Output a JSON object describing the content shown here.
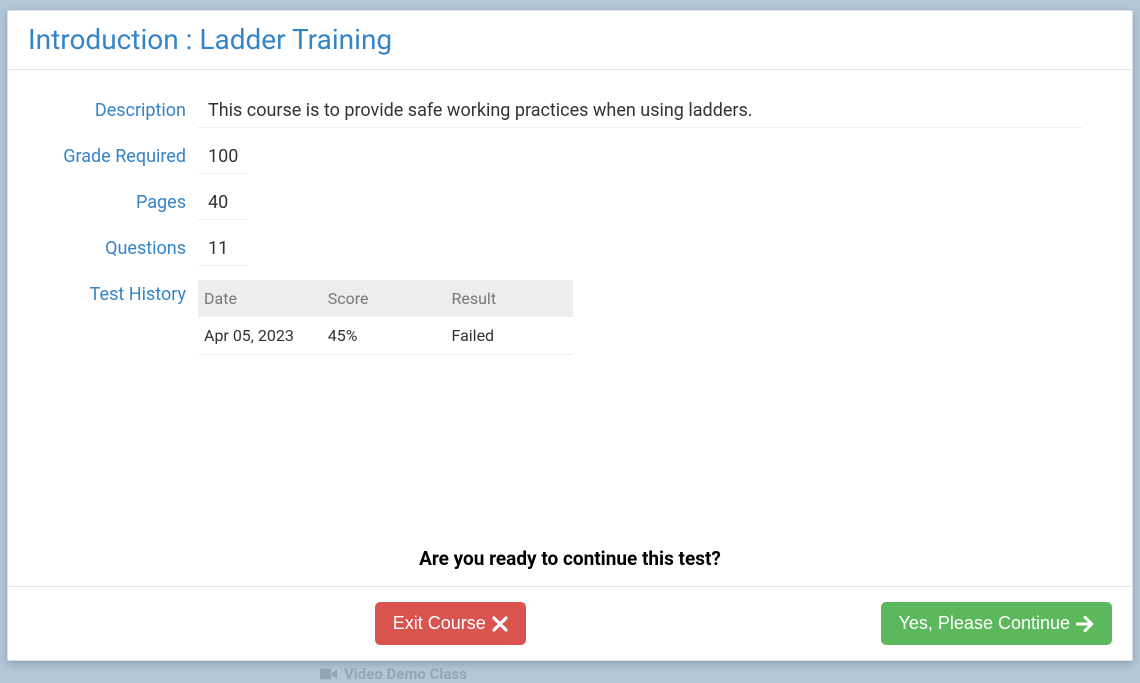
{
  "modal": {
    "title": "Introduction : Ladder Training"
  },
  "fields": {
    "description_label": "Description",
    "description_value": "This course is to provide safe working practices when using ladders.",
    "grade_label": "Grade Required",
    "grade_value": "100",
    "pages_label": "Pages",
    "pages_value": "40",
    "questions_label": "Questions",
    "questions_value": "11",
    "history_label": "Test History"
  },
  "history": {
    "headers": {
      "date": "Date",
      "score": "Score",
      "result": "Result"
    },
    "rows": [
      {
        "date": "Apr 05, 2023",
        "score": "45%",
        "result": "Failed"
      }
    ]
  },
  "prompt": "Are you ready to continue this test?",
  "buttons": {
    "exit": "Exit Course",
    "continue": "Yes, Please Continue"
  },
  "background": {
    "hint": "Video Demo Class"
  }
}
